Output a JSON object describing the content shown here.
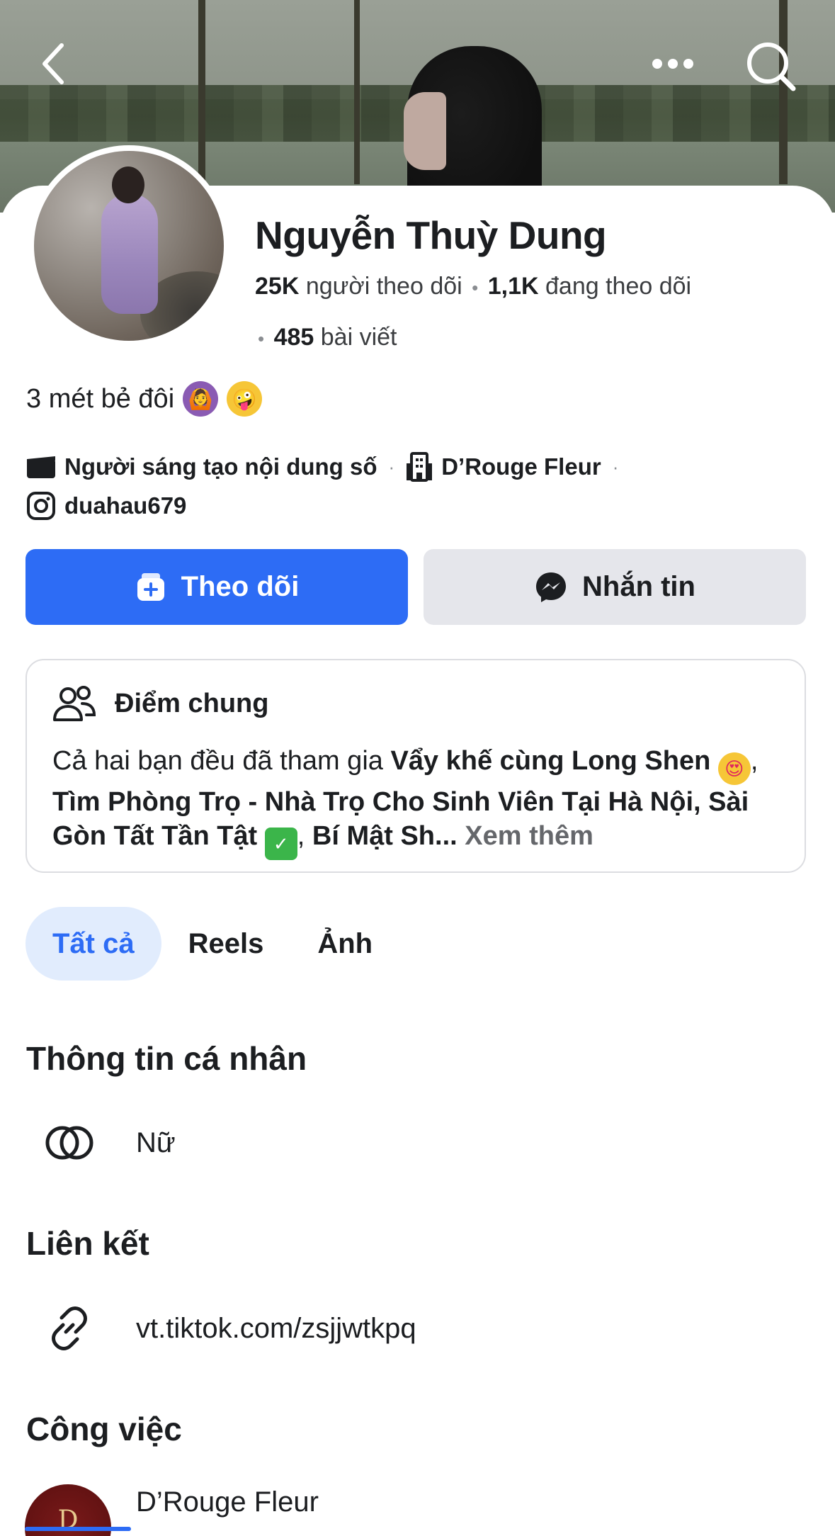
{
  "profile": {
    "name": "Nguyễn Thuỳ Dung",
    "followers_count": "25K",
    "followers_label": "người theo dõi",
    "following_count": "1,1K",
    "following_label": "đang theo dõi",
    "posts_count": "485",
    "posts_label": "bài viết",
    "bio": "3 mét bẻ đôi"
  },
  "meta": {
    "category": "Người sáng tạo nội dung số",
    "workplace": "D’Rouge Fleur",
    "instagram": "duahau679"
  },
  "actions": {
    "follow_label": "Theo dõi",
    "message_label": "Nhắn tin"
  },
  "common": {
    "title": "Điểm chung",
    "intro": "Cả hai bạn đều đã tham gia ",
    "group1": "Vẩy khế cùng Long Shen",
    "group2": "Tìm Phòng Trọ - Nhà Trọ Cho Sinh Viên Tại Hà Nội, Sài Gòn Tất Tần Tật",
    "group3": "Bí Mật Sh...",
    "see_more": "Xem thêm"
  },
  "tabs": [
    {
      "label": "Tất cả",
      "active": true
    },
    {
      "label": "Reels",
      "active": false
    },
    {
      "label": "Ảnh",
      "active": false
    }
  ],
  "sections": {
    "personal_info": {
      "title": "Thông tin cá nhân",
      "gender": "Nữ"
    },
    "links": {
      "title": "Liên kết",
      "url": "vt.tiktok.com/zsjjwtkpq"
    },
    "work": {
      "title": "Công việc",
      "company": "D’Rouge Fleur",
      "logo_text": "D"
    }
  },
  "icons": {
    "back": "chevron-left-icon",
    "more": "more-dots-icon",
    "search": "search-icon",
    "category": "clapperboard-icon",
    "workplace": "building-icon",
    "instagram": "instagram-icon",
    "follow": "follow-plus-icon",
    "message": "messenger-icon",
    "common": "people-icon",
    "gender": "gender-rings-icon",
    "link": "link-icon"
  },
  "colors": {
    "primary": "#2d6cf5",
    "secondary_button": "#e5e6eb",
    "tab_active_bg": "#e1ecfd"
  }
}
